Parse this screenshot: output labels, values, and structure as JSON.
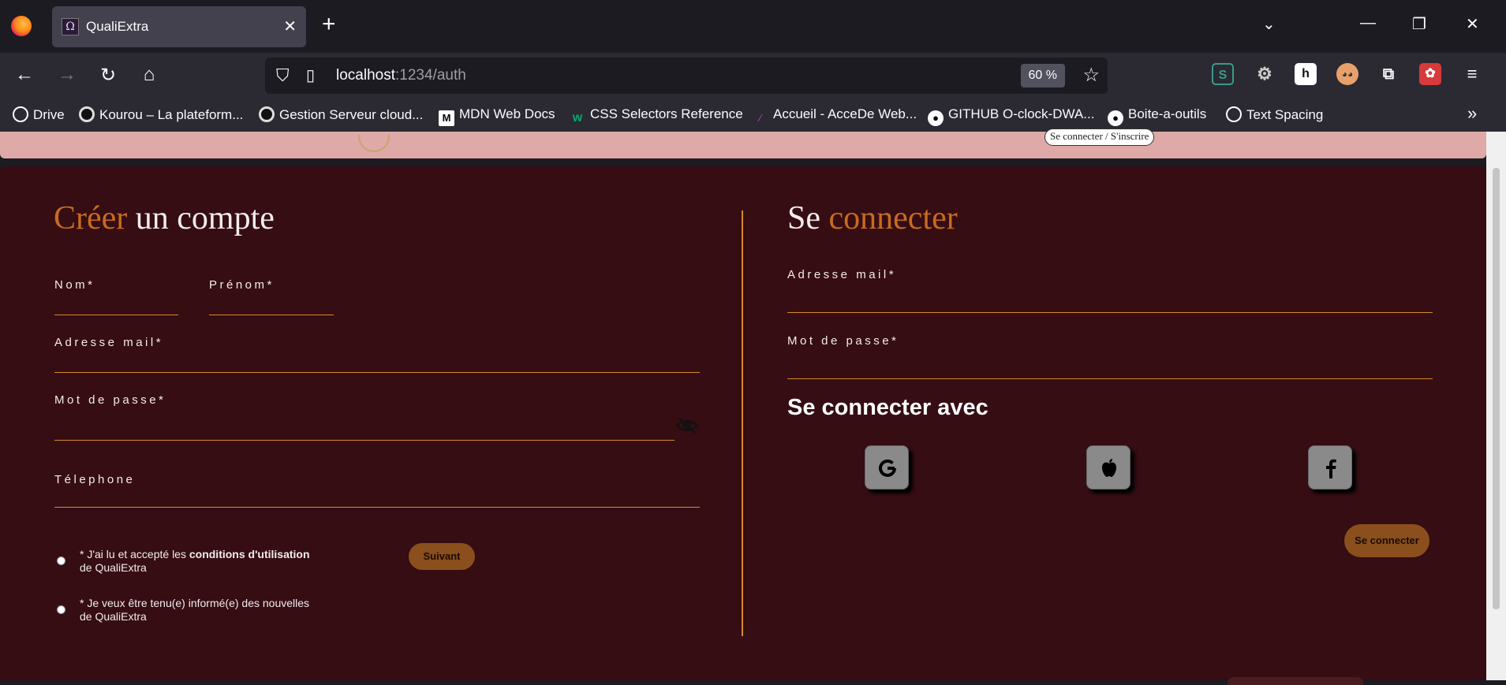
{
  "browser": {
    "tab_title": "QualiExtra",
    "tab_favicon": "Ω",
    "url_host": "localhost",
    "url_rest": ":1234/auth",
    "zoom": "60 %",
    "bookmarks": [
      {
        "label": "Drive",
        "icon": "globe-icon"
      },
      {
        "label": "Kourou – La plateform...",
        "icon": "kourou-icon"
      },
      {
        "label": "Gestion Serveur cloud...",
        "icon": "cloud-icon"
      },
      {
        "label": "MDN Web Docs",
        "icon": "mdn-icon"
      },
      {
        "label": "CSS Selectors Reference",
        "icon": "w3schools-icon"
      },
      {
        "label": "Accueil - AcceDe Web...",
        "icon": "accede-icon"
      },
      {
        "label": "GITHUB O-clock-DWA...",
        "icon": "github-icon"
      },
      {
        "label": "Boite-a-outils",
        "icon": "github-icon"
      },
      {
        "label": "Text Spacing",
        "icon": "globe-icon"
      }
    ]
  },
  "header": {
    "login_pill": "Se connecter / S'inscrire"
  },
  "signup": {
    "title_accent": "Créer",
    "title_rest": " un compte",
    "label_nom": "Nom*",
    "label_prenom": "Prénom*",
    "label_email": "Adresse mail*",
    "label_password": "Mot de passe*",
    "label_phone": "Télephone",
    "terms_prefix": "* J'ai lu et accepté les ",
    "terms_bold": "conditions d'utilisation",
    "terms_suffix": "de QualiExtra",
    "news_line1": "* Je veux être tenu(e) informé(e) des nouvelles",
    "news_line2": "de QualiExtra",
    "next_button": "Suivant"
  },
  "login": {
    "title_plain": "Se ",
    "title_accent": "connecter",
    "label_email": "Adresse mail*",
    "label_password": "Mot de passe*",
    "social_title": "Se connecter avec",
    "social": [
      "google-icon",
      "apple-icon",
      "facebook-icon"
    ],
    "submit_button": "Se connecter"
  },
  "colors": {
    "background": "#350d13",
    "accent": "#c86b1e",
    "line": "#d48a2b",
    "button": "#8a4f1c",
    "header": "#dea9a7"
  }
}
